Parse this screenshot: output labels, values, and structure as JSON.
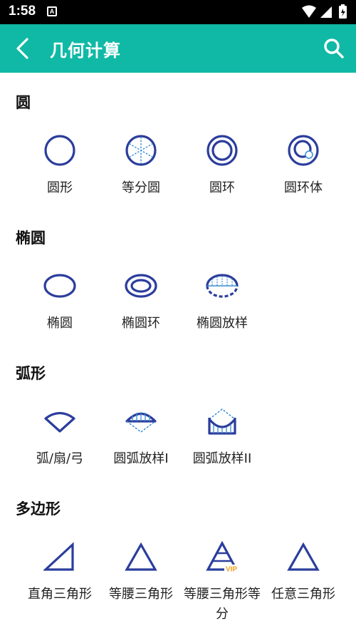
{
  "status_bar": {
    "time": "1:58",
    "notification_icon": "A"
  },
  "app_bar": {
    "title": "几何计算",
    "back_icon": "chevron-left-icon",
    "search_icon": "search-icon"
  },
  "colors": {
    "accent": "#10b9a5",
    "icon_stroke": "#2b3d9c",
    "icon_dash": "#3a8fd6",
    "vip": "#f0a020"
  },
  "sections": [
    {
      "title": "圆",
      "items": [
        {
          "label": "圆形"
        },
        {
          "label": "等分圆"
        },
        {
          "label": "圆环"
        },
        {
          "label": "圆环体"
        }
      ]
    },
    {
      "title": "椭圆",
      "items": [
        {
          "label": "椭圆"
        },
        {
          "label": "椭圆环"
        },
        {
          "label": "椭圆放样"
        }
      ]
    },
    {
      "title": "弧形",
      "items": [
        {
          "label": "弧/扇/弓"
        },
        {
          "label": "圆弧放样I"
        },
        {
          "label": "圆弧放样II"
        }
      ]
    },
    {
      "title": "多边形",
      "items": [
        {
          "label": "直角三角形"
        },
        {
          "label": "等腰三角形"
        },
        {
          "label": "等腰三角形等分",
          "badge": "VIP"
        },
        {
          "label": "任意三角形"
        }
      ]
    }
  ]
}
